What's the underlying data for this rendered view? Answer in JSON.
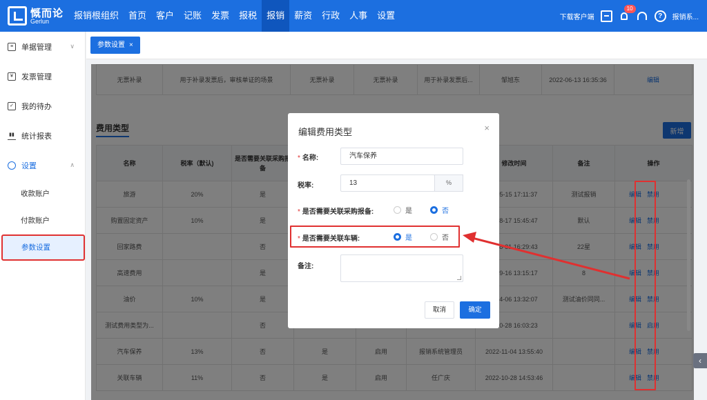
{
  "brand": {
    "name_cn": "慨而论",
    "name_en": "Gerlun"
  },
  "nav": [
    {
      "label": "报销根组织"
    },
    {
      "label": "首页"
    },
    {
      "label": "客户"
    },
    {
      "label": "记账"
    },
    {
      "label": "发票"
    },
    {
      "label": "报税"
    },
    {
      "label": "报销",
      "active": true
    },
    {
      "label": "薪资"
    },
    {
      "label": "行政"
    },
    {
      "label": "人事"
    },
    {
      "label": "设置"
    }
  ],
  "topright": {
    "download": "下载客户端",
    "notif_count": "10",
    "user": "报销系..."
  },
  "sidebar": {
    "items": [
      {
        "label": "单据管理",
        "icon": "document-icon"
      },
      {
        "label": "发票管理",
        "icon": "invoice-icon"
      },
      {
        "label": "我的待办",
        "icon": "todo-icon"
      },
      {
        "label": "统计报表",
        "icon": "chart-icon"
      },
      {
        "label": "设置",
        "icon": "gear-icon",
        "expanded": true
      }
    ],
    "subitems": [
      {
        "label": "收款账户"
      },
      {
        "label": "付款账户"
      },
      {
        "label": "参数设置",
        "active": true
      }
    ]
  },
  "tab": {
    "label": "参数设置",
    "close": "×"
  },
  "top_table": {
    "row": [
      "无票补录",
      "用于补录发票后，审核单证的场景",
      "无票补录",
      "无票补录",
      "用于补录发票后...",
      "邹旭东",
      "2022-06-13 16:35:36",
      "编辑"
    ]
  },
  "section": {
    "title": "费用类型",
    "add_button": "新增"
  },
  "expense_table": {
    "headers": [
      "名称",
      "税率（默认)",
      "是否需要关联采购报备",
      "",
      "",
      "",
      "修改时间",
      "备注",
      "操作"
    ],
    "rows": [
      {
        "cells": [
          "旅游",
          "20%",
          "是",
          "",
          "",
          "",
          "1-05-15 17:11:37",
          "测试报销"
        ],
        "edit": "编辑",
        "toggle": "禁用"
      },
      {
        "cells": [
          "购置固定资产",
          "10%",
          "是",
          "",
          "",
          "",
          "1-08-17 15:45:47",
          "默认"
        ],
        "edit": "编辑",
        "toggle": "禁用"
      },
      {
        "cells": [
          "回家路费",
          "",
          "否",
          "",
          "",
          "",
          "1-08-31 16:29:43",
          "22星"
        ],
        "edit": "编辑",
        "toggle": "禁用"
      },
      {
        "cells": [
          "高速费用",
          "",
          "是",
          "",
          "",
          "",
          "1-09-16 13:15:17",
          "8"
        ],
        "edit": "编辑",
        "toggle": "禁用"
      },
      {
        "cells": [
          "油价",
          "10%",
          "是",
          "",
          "",
          "",
          "2-04-06 13:32:07",
          "测试油价同同..."
        ],
        "edit": "编辑",
        "toggle": "禁用"
      },
      {
        "cells": [
          "测试费用类型为...",
          "",
          "否",
          "",
          "",
          "",
          "2-10-28 16:03:23",
          ""
        ],
        "edit": "编辑",
        "toggle": "启用"
      },
      {
        "cells": [
          "汽车保养",
          "13%",
          "否",
          "是",
          "启用",
          "报销系统管理员",
          "2022-11-04 13:55:40",
          ""
        ],
        "edit": "编辑",
        "toggle": "禁用"
      },
      {
        "cells": [
          "关联车辆",
          "11%",
          "否",
          "是",
          "启用",
          "任广庆",
          "2022-10-28 14:53:46",
          ""
        ],
        "edit": "编辑",
        "toggle": "禁用"
      }
    ]
  },
  "modal": {
    "title": "编辑费用类型",
    "close": "×",
    "name_label": "名称:",
    "name_value": "汽车保养",
    "tax_label": "税率:",
    "tax_value": "13",
    "tax_unit": "%",
    "purchase_label": "是否需要关联采购报备:",
    "vehicle_label": "是否需要关联车辆:",
    "yes": "是",
    "no": "否",
    "purchase_selected": "否",
    "vehicle_selected": "是",
    "note_label": "备注:",
    "cancel": "取消",
    "ok": "确定"
  },
  "colors": {
    "primary": "#1c6fe0",
    "highlight": "#e03030"
  }
}
